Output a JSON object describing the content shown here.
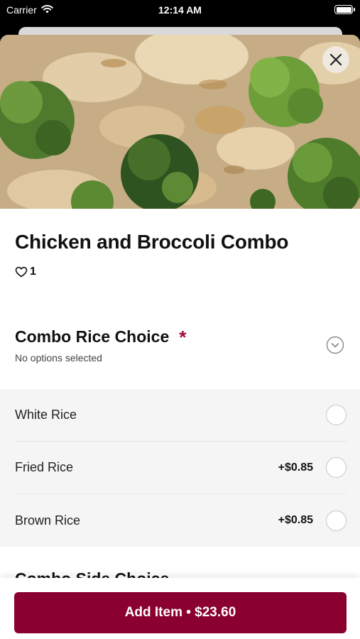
{
  "status_bar": {
    "carrier": "Carrier",
    "time": "12:14 AM",
    "wifi_icon": "wifi-icon",
    "battery_icon": "battery-icon"
  },
  "item": {
    "title": "Chicken and Broccoli Combo",
    "like_count": "1",
    "like_icon": "heart-outline-icon"
  },
  "close_icon": "close-icon",
  "option_group": {
    "title": "Combo Rice Choice",
    "required_marker": "*",
    "subtitle": "No options selected",
    "expand_icon": "chevron-down-circle-icon",
    "options": [
      {
        "label": "White Rice",
        "price": ""
      },
      {
        "label": "Fried Rice",
        "price": "+$0.85"
      },
      {
        "label": "Brown Rice",
        "price": "+$0.85"
      }
    ]
  },
  "next_group": {
    "title": "Combo Side Choice"
  },
  "footer": {
    "add_button_label": "Add Item • $23.60"
  },
  "colors": {
    "accent": "#8a0030",
    "required": "#a00a36",
    "options_background": "#f5f5f5"
  }
}
